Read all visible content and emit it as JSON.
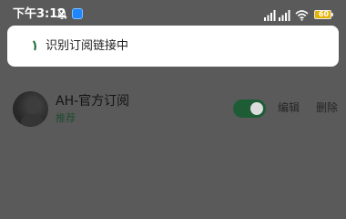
{
  "status_bar": {
    "time": "下午3:12",
    "battery_level": "60",
    "icons": [
      "bell-muted-icon",
      "app-notification-icon",
      "signal-icon",
      "signal-icon",
      "wifi-icon",
      "battery-icon"
    ]
  },
  "toast": {
    "message": "识别订阅链接中",
    "icon": "loading-spinner-icon"
  },
  "subscription": {
    "title": "AH-官方订阅",
    "tag": "推荐",
    "enabled": true,
    "edit_label": "编辑",
    "delete_label": "删除"
  },
  "colors": {
    "overlay": "#5a5a5a",
    "toggle_on": "#1e5c36",
    "tag": "#1f4a30",
    "spinner": "#1f6b3d"
  }
}
